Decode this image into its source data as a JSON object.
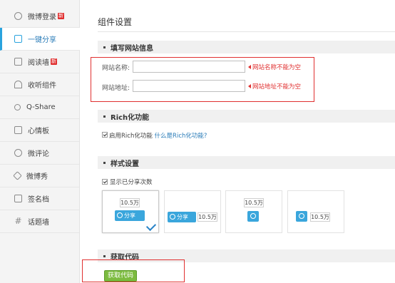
{
  "sidebar": {
    "items": [
      {
        "label": "微博登录",
        "badge": "新",
        "icon": "user-icon"
      },
      {
        "label": "一键分享",
        "active": true,
        "icon": "share-icon"
      },
      {
        "label": "阅读墙",
        "badge": "新",
        "icon": "document-icon"
      },
      {
        "label": "收听组件",
        "icon": "headphones-icon"
      },
      {
        "label": "Q-Share",
        "icon": "network-icon"
      },
      {
        "label": "心情板",
        "icon": "monitor-icon"
      },
      {
        "label": "微评论",
        "icon": "comment-icon"
      },
      {
        "label": "微博秀",
        "icon": "star-icon"
      },
      {
        "label": "签名档",
        "icon": "signature-icon"
      },
      {
        "label": "话题墙",
        "icon": "hash-icon"
      }
    ]
  },
  "main": {
    "title": "组件设置",
    "site_info": {
      "heading": "填写网站信息",
      "name_label": "网站名称:",
      "name_value": "",
      "name_error": "网站名称不能为空",
      "url_label": "网站地址:",
      "url_value": "",
      "url_error": "网站地址不能为空"
    },
    "rich": {
      "heading": "Rich化功能",
      "checkbox_label": "启用Rich化功能",
      "checked": true,
      "help_link": "什么是Rich化功能?"
    },
    "style": {
      "heading": "样式设置",
      "checkbox_label": "显示已分享次数",
      "checked": true,
      "count": "10.5万",
      "share_text": "分享",
      "selected_index": 0
    },
    "get_code": {
      "heading": "获取代码",
      "button_label": "获取代码"
    }
  },
  "colors": {
    "accent": "#2aa3de",
    "error": "#e03030",
    "button_green": "#7cbb3f"
  }
}
